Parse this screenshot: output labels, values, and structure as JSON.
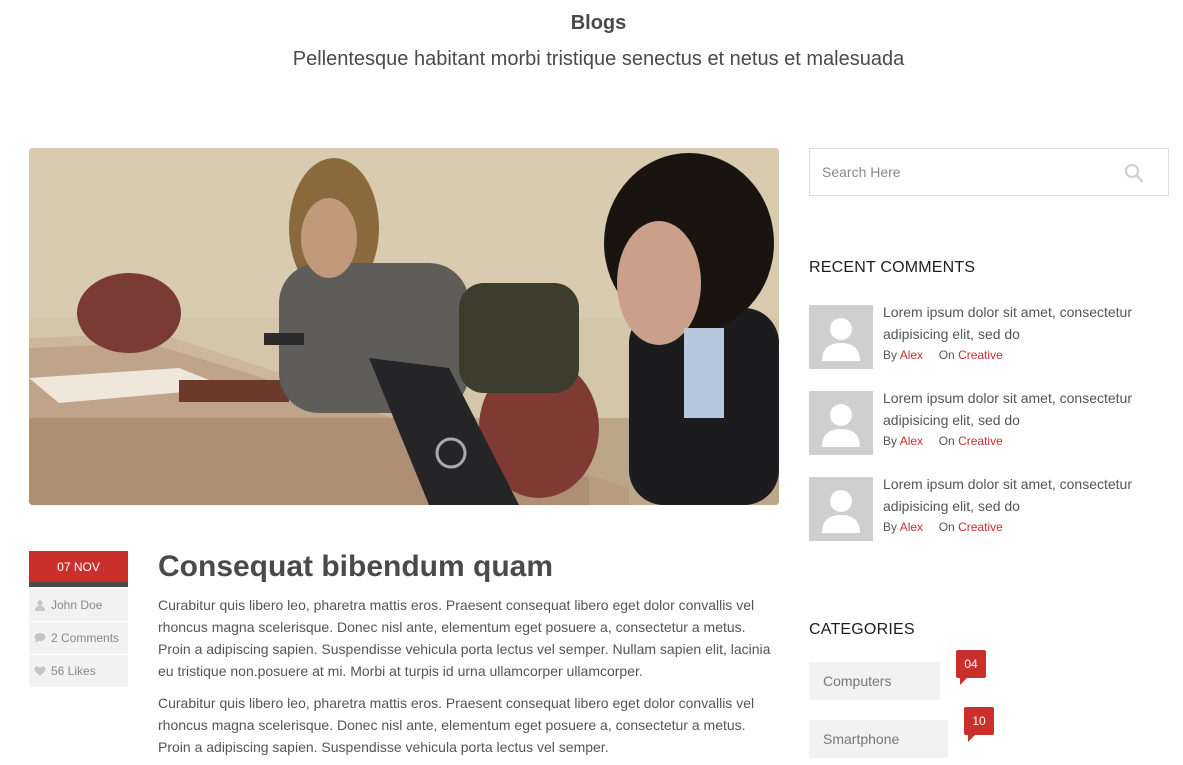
{
  "header": {
    "title": "Blogs",
    "subtitle": "Pellentesque habitant morbi tristique senectus et netus et malesuada"
  },
  "post": {
    "date": "07 NOV",
    "author": "John Doe",
    "comments": "2 Comments",
    "likes": "56 Likes",
    "title": "Consequat bibendum quam",
    "paragraphs": [
      "Curabitur quis libero leo, pharetra mattis eros. Praesent consequat libero eget dolor convallis vel rhoncus magna scelerisque. Donec nisl ante, elementum eget posuere a, consectetur a metus. Proin a adipiscing sapien. Suspendisse vehicula porta lectus vel semper. Nullam sapien elit, lacinia eu tristique non.posuere at mi. Morbi at turpis id urna ullamcorper ullamcorper.",
      "Curabitur quis libero leo, pharetra mattis eros. Praesent consequat libero eget dolor convallis vel rhoncus magna scelerisque. Donec nisl ante, elementum eget posuere a, consectetur a metus. Proin a adipiscing sapien. Suspendisse vehicula porta lectus vel semper."
    ]
  },
  "sidebar": {
    "search": {
      "placeholder": "Search Here"
    },
    "recent_heading": "RECENT COMMENTS",
    "comments": [
      {
        "text": "Lorem ipsum dolor sit amet, consectetur adipisicing elit, sed do",
        "by_label": "By",
        "author": "Alex",
        "on_label": "On",
        "category": "Creative"
      },
      {
        "text": "Lorem ipsum dolor sit amet, consectetur adipisicing elit, sed do",
        "by_label": "By",
        "author": "Alex",
        "on_label": "On",
        "category": "Creative"
      },
      {
        "text": "Lorem ipsum dolor sit amet, consectetur adipisicing elit, sed do",
        "by_label": "By",
        "author": "Alex",
        "on_label": "On",
        "category": "Creative"
      }
    ],
    "categories_heading": "CATEGORIES",
    "categories": [
      {
        "name": "Computers",
        "count": "04"
      },
      {
        "name": "Smartphone",
        "count": "10"
      }
    ]
  },
  "colors": {
    "accent": "#c9302c",
    "meta_bg": "#f2f2f2",
    "dark_bar": "#4a4a4a"
  },
  "icons": [
    "search-icon",
    "user-icon",
    "comment-icon",
    "heart-icon",
    "avatar-placeholder-icon"
  ]
}
